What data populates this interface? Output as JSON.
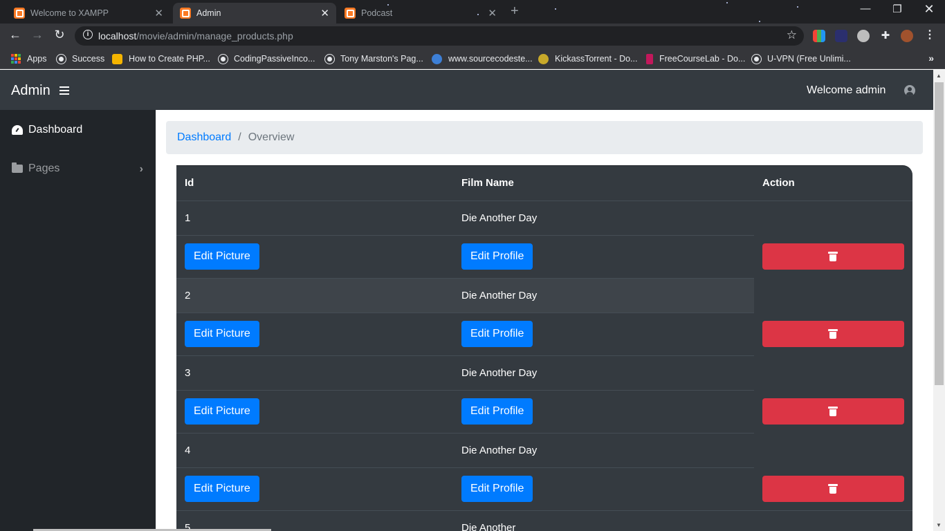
{
  "browser": {
    "tabs": [
      {
        "title": "Welcome to XAMPP",
        "active": false
      },
      {
        "title": "Admin",
        "active": true
      },
      {
        "title": "Podcast",
        "active": false
      }
    ],
    "url_host": "localhost",
    "url_path": "/movie/admin/manage_products.php",
    "bookmarks": [
      {
        "label": "Apps"
      },
      {
        "label": "Success"
      },
      {
        "label": "How to Create PHP..."
      },
      {
        "label": "CodingPassiveInco..."
      },
      {
        "label": "Tony Marston's Pag..."
      },
      {
        "label": "www.sourcecodeste..."
      },
      {
        "label": "KickassTorrent - Do..."
      },
      {
        "label": "FreeCourseLab - Do..."
      },
      {
        "label": "U-VPN (Free Unlimi..."
      }
    ]
  },
  "navbar": {
    "brand": "Admin",
    "welcome": "Welcome admin"
  },
  "sidebar": {
    "items": [
      {
        "label": "Dashboard"
      },
      {
        "label": "Pages"
      }
    ]
  },
  "breadcrumb": {
    "link": "Dashboard",
    "separator": "/",
    "current": "Overview"
  },
  "table": {
    "headers": [
      "Id",
      "Film Name",
      "Action"
    ],
    "edit_picture_label": "Edit Picture",
    "edit_profile_label": "Edit Profile",
    "rows": [
      {
        "id": "1",
        "film": "Die Another Day"
      },
      {
        "id": "2",
        "film": "Die Another Day"
      },
      {
        "id": "3",
        "film": "Die Another Day"
      },
      {
        "id": "4",
        "film": "Die Another Day"
      },
      {
        "id": "5",
        "film": "Die Another"
      }
    ]
  },
  "colors": {
    "navbar": "#343a40",
    "sidebar": "#212529",
    "primary": "#007bff",
    "danger": "#dc3545"
  }
}
